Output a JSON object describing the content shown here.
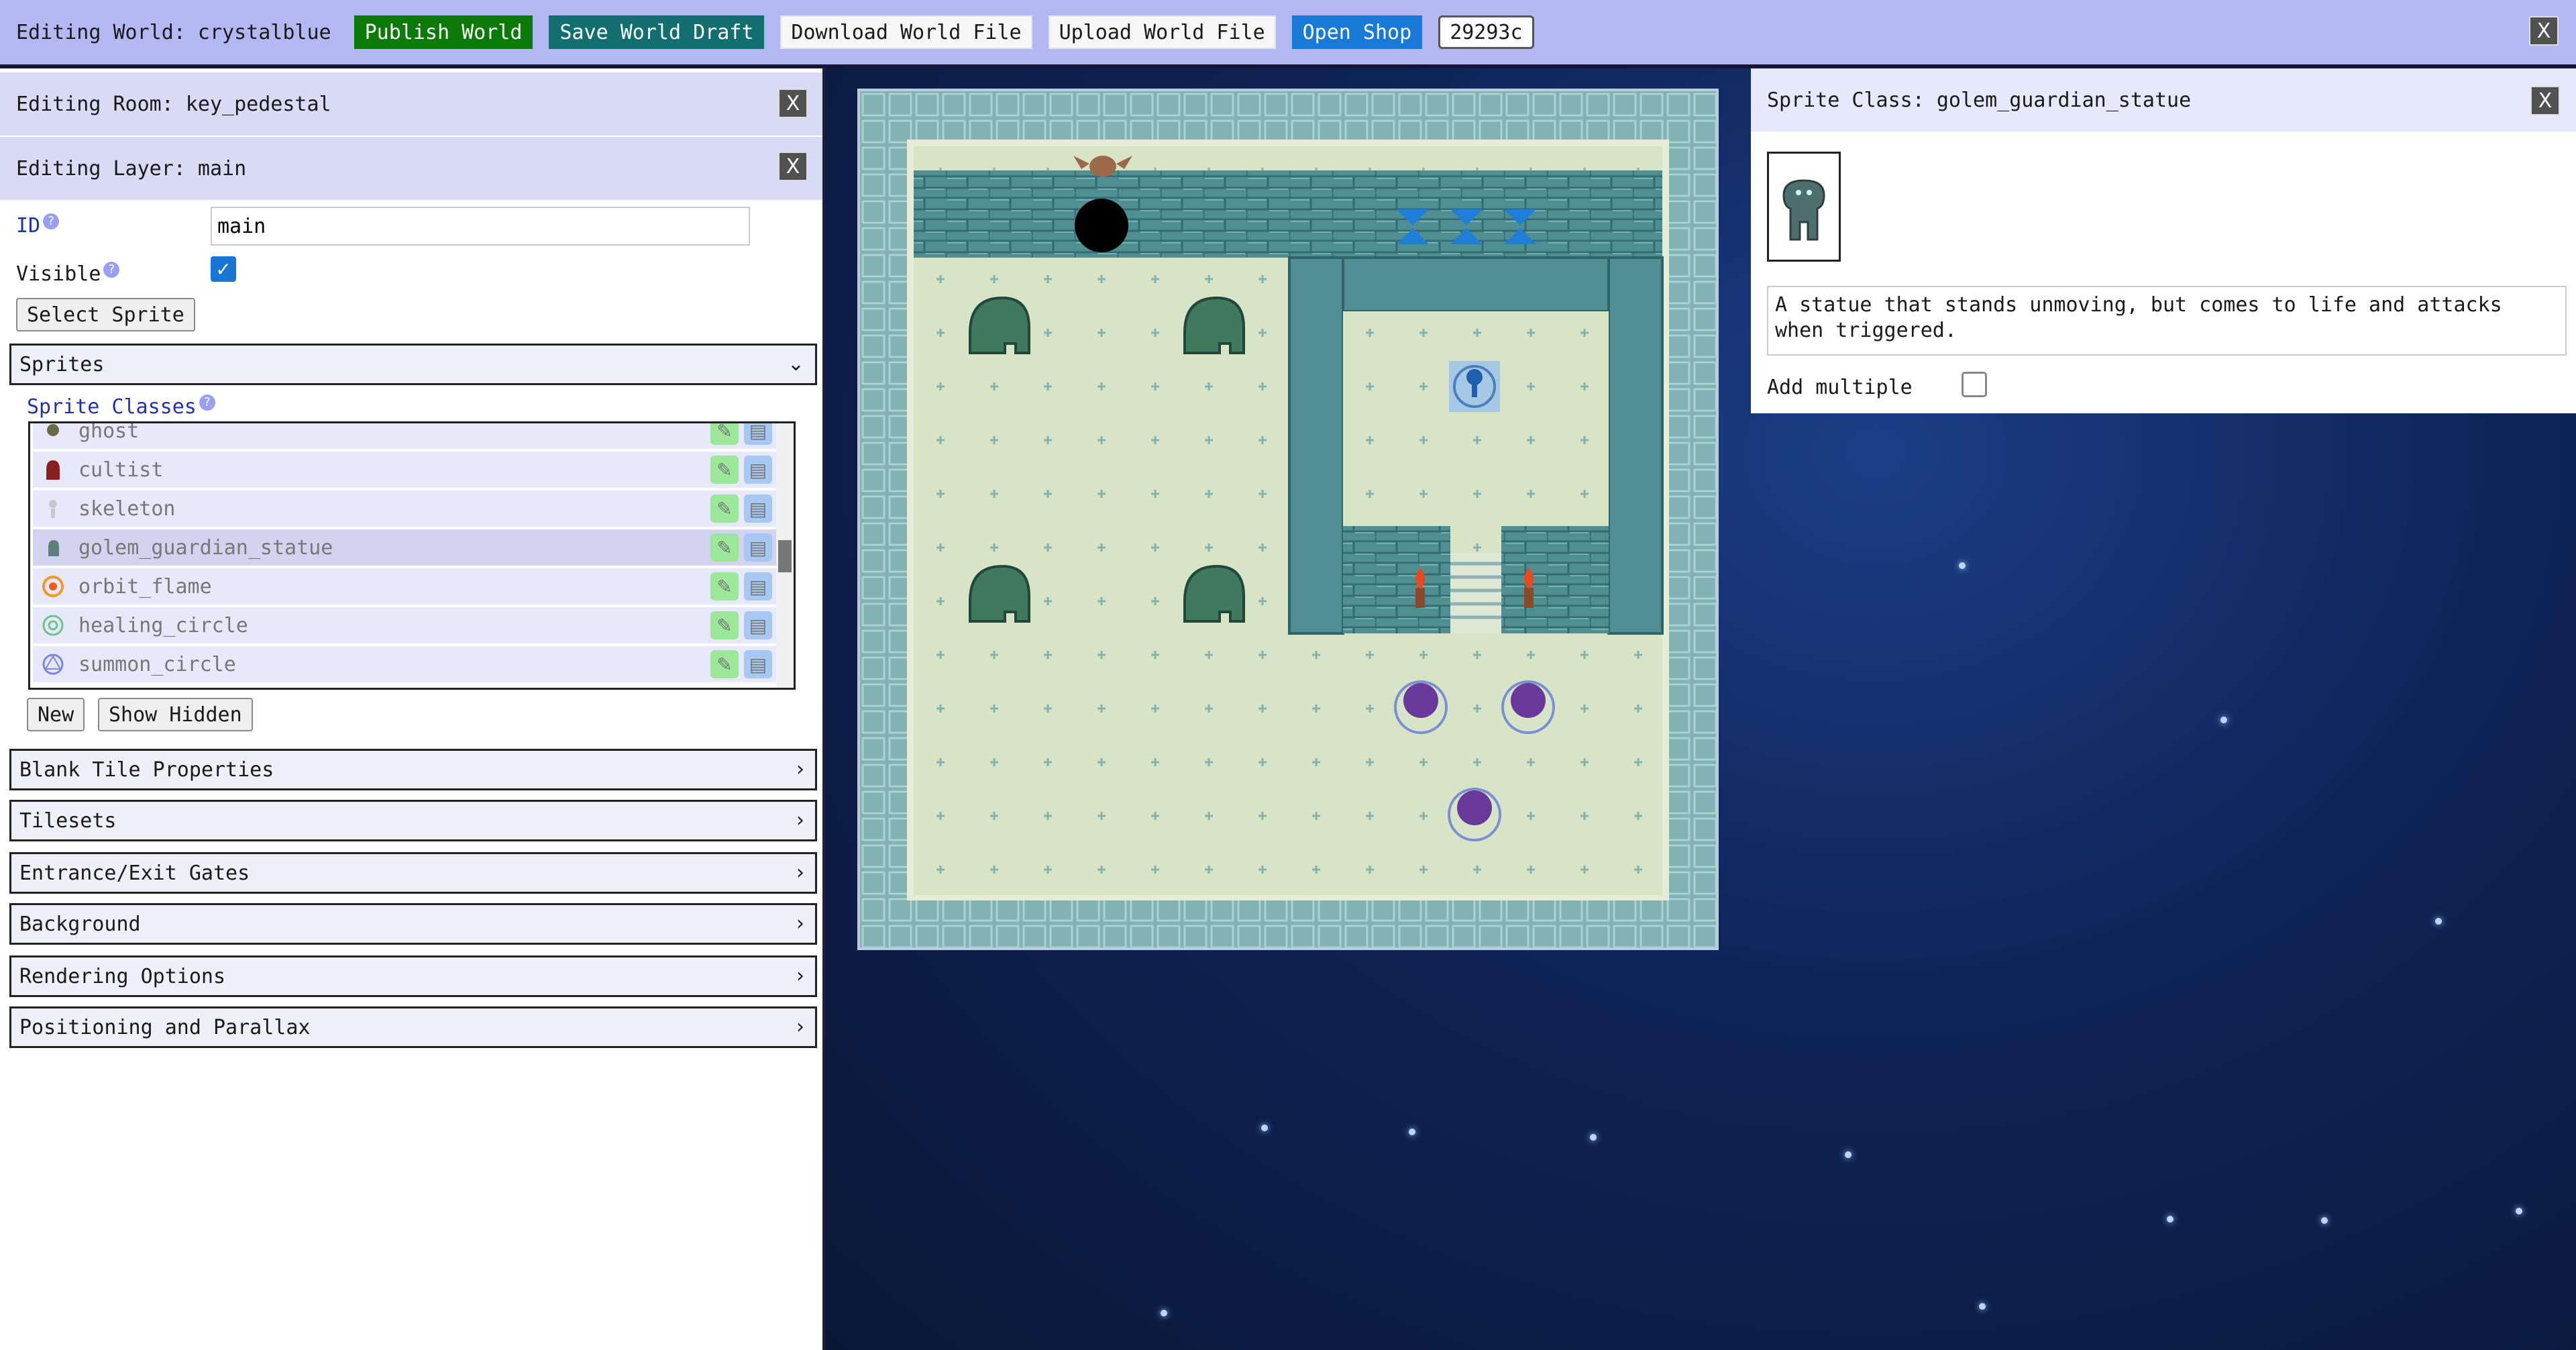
{
  "topbar": {
    "title": "Editing World: crystalblue",
    "publish_label": "Publish World",
    "save_draft_label": "Save World Draft",
    "download_label": "Download World File",
    "upload_label": "Upload World File",
    "shop_label": "Open Shop",
    "counter": "29293c",
    "close_label": "X"
  },
  "room_panel": {
    "title": "Editing Room: key_pedestal",
    "close_label": "X"
  },
  "layer_panel": {
    "title": "Editing Layer: main",
    "close_label": "X",
    "id_label": "ID",
    "id_value": "main",
    "visible_label": "Visible",
    "visible_checked": true,
    "select_sprite_label": "Select Sprite"
  },
  "sprites_section": {
    "title": "Sprites",
    "expanded": true,
    "classes_label": "Sprite Classes",
    "classes": [
      {
        "name": "ghost",
        "icon": "ghost-icon"
      },
      {
        "name": "cultist",
        "icon": "cultist-icon"
      },
      {
        "name": "skeleton",
        "icon": "skeleton-icon"
      },
      {
        "name": "golem_guardian_statue",
        "icon": "golem-icon",
        "selected": true
      },
      {
        "name": "orbit_flame",
        "icon": "flame-icon"
      },
      {
        "name": "healing_circle",
        "icon": "healing-circle-icon"
      },
      {
        "name": "summon_circle",
        "icon": "summon-circle-icon"
      }
    ],
    "new_label": "New",
    "show_hidden_label": "Show Hidden"
  },
  "sections": [
    {
      "title": "Blank Tile Properties"
    },
    {
      "title": "Tilesets"
    },
    {
      "title": "Entrance/Exit Gates"
    },
    {
      "title": "Background"
    },
    {
      "title": "Rendering Options"
    },
    {
      "title": "Positioning and Parallax"
    }
  ],
  "sprite_class_panel": {
    "title": "Sprite Class: golem_guardian_statue",
    "close_label": "X",
    "description": "A statue that stands unmoving, but comes to life and attacks when triggered.",
    "add_multiple_label": "Add multiple",
    "add_multiple_checked": false
  },
  "colors": {
    "topbar": "#b4b8f2",
    "publish": "#0b7a08",
    "save_draft": "#136e70",
    "shop": "#1979d6",
    "floor": "#d7e4c6",
    "wall": "#4f8f94"
  }
}
